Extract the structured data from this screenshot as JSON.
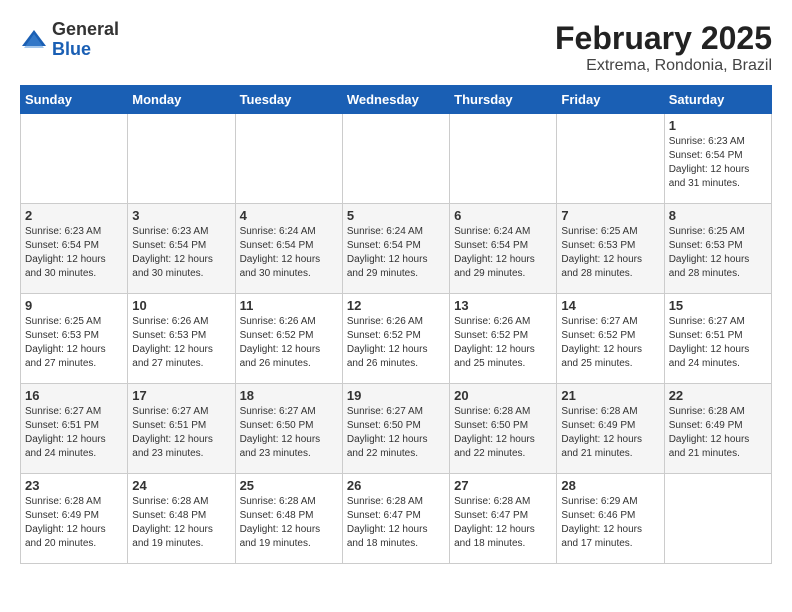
{
  "header": {
    "logo_general": "General",
    "logo_blue": "Blue",
    "month": "February 2025",
    "location": "Extrema, Rondonia, Brazil"
  },
  "weekdays": [
    "Sunday",
    "Monday",
    "Tuesday",
    "Wednesday",
    "Thursday",
    "Friday",
    "Saturday"
  ],
  "weeks": [
    [
      {
        "day": "",
        "info": ""
      },
      {
        "day": "",
        "info": ""
      },
      {
        "day": "",
        "info": ""
      },
      {
        "day": "",
        "info": ""
      },
      {
        "day": "",
        "info": ""
      },
      {
        "day": "",
        "info": ""
      },
      {
        "day": "1",
        "info": "Sunrise: 6:23 AM\nSunset: 6:54 PM\nDaylight: 12 hours\nand 31 minutes."
      }
    ],
    [
      {
        "day": "2",
        "info": "Sunrise: 6:23 AM\nSunset: 6:54 PM\nDaylight: 12 hours\nand 30 minutes."
      },
      {
        "day": "3",
        "info": "Sunrise: 6:23 AM\nSunset: 6:54 PM\nDaylight: 12 hours\nand 30 minutes."
      },
      {
        "day": "4",
        "info": "Sunrise: 6:24 AM\nSunset: 6:54 PM\nDaylight: 12 hours\nand 30 minutes."
      },
      {
        "day": "5",
        "info": "Sunrise: 6:24 AM\nSunset: 6:54 PM\nDaylight: 12 hours\nand 29 minutes."
      },
      {
        "day": "6",
        "info": "Sunrise: 6:24 AM\nSunset: 6:54 PM\nDaylight: 12 hours\nand 29 minutes."
      },
      {
        "day": "7",
        "info": "Sunrise: 6:25 AM\nSunset: 6:53 PM\nDaylight: 12 hours\nand 28 minutes."
      },
      {
        "day": "8",
        "info": "Sunrise: 6:25 AM\nSunset: 6:53 PM\nDaylight: 12 hours\nand 28 minutes."
      }
    ],
    [
      {
        "day": "9",
        "info": "Sunrise: 6:25 AM\nSunset: 6:53 PM\nDaylight: 12 hours\nand 27 minutes."
      },
      {
        "day": "10",
        "info": "Sunrise: 6:26 AM\nSunset: 6:53 PM\nDaylight: 12 hours\nand 27 minutes."
      },
      {
        "day": "11",
        "info": "Sunrise: 6:26 AM\nSunset: 6:52 PM\nDaylight: 12 hours\nand 26 minutes."
      },
      {
        "day": "12",
        "info": "Sunrise: 6:26 AM\nSunset: 6:52 PM\nDaylight: 12 hours\nand 26 minutes."
      },
      {
        "day": "13",
        "info": "Sunrise: 6:26 AM\nSunset: 6:52 PM\nDaylight: 12 hours\nand 25 minutes."
      },
      {
        "day": "14",
        "info": "Sunrise: 6:27 AM\nSunset: 6:52 PM\nDaylight: 12 hours\nand 25 minutes."
      },
      {
        "day": "15",
        "info": "Sunrise: 6:27 AM\nSunset: 6:51 PM\nDaylight: 12 hours\nand 24 minutes."
      }
    ],
    [
      {
        "day": "16",
        "info": "Sunrise: 6:27 AM\nSunset: 6:51 PM\nDaylight: 12 hours\nand 24 minutes."
      },
      {
        "day": "17",
        "info": "Sunrise: 6:27 AM\nSunset: 6:51 PM\nDaylight: 12 hours\nand 23 minutes."
      },
      {
        "day": "18",
        "info": "Sunrise: 6:27 AM\nSunset: 6:50 PM\nDaylight: 12 hours\nand 23 minutes."
      },
      {
        "day": "19",
        "info": "Sunrise: 6:27 AM\nSunset: 6:50 PM\nDaylight: 12 hours\nand 22 minutes."
      },
      {
        "day": "20",
        "info": "Sunrise: 6:28 AM\nSunset: 6:50 PM\nDaylight: 12 hours\nand 22 minutes."
      },
      {
        "day": "21",
        "info": "Sunrise: 6:28 AM\nSunset: 6:49 PM\nDaylight: 12 hours\nand 21 minutes."
      },
      {
        "day": "22",
        "info": "Sunrise: 6:28 AM\nSunset: 6:49 PM\nDaylight: 12 hours\nand 21 minutes."
      }
    ],
    [
      {
        "day": "23",
        "info": "Sunrise: 6:28 AM\nSunset: 6:49 PM\nDaylight: 12 hours\nand 20 minutes."
      },
      {
        "day": "24",
        "info": "Sunrise: 6:28 AM\nSunset: 6:48 PM\nDaylight: 12 hours\nand 19 minutes."
      },
      {
        "day": "25",
        "info": "Sunrise: 6:28 AM\nSunset: 6:48 PM\nDaylight: 12 hours\nand 19 minutes."
      },
      {
        "day": "26",
        "info": "Sunrise: 6:28 AM\nSunset: 6:47 PM\nDaylight: 12 hours\nand 18 minutes."
      },
      {
        "day": "27",
        "info": "Sunrise: 6:28 AM\nSunset: 6:47 PM\nDaylight: 12 hours\nand 18 minutes."
      },
      {
        "day": "28",
        "info": "Sunrise: 6:29 AM\nSunset: 6:46 PM\nDaylight: 12 hours\nand 17 minutes."
      },
      {
        "day": "",
        "info": ""
      }
    ]
  ]
}
